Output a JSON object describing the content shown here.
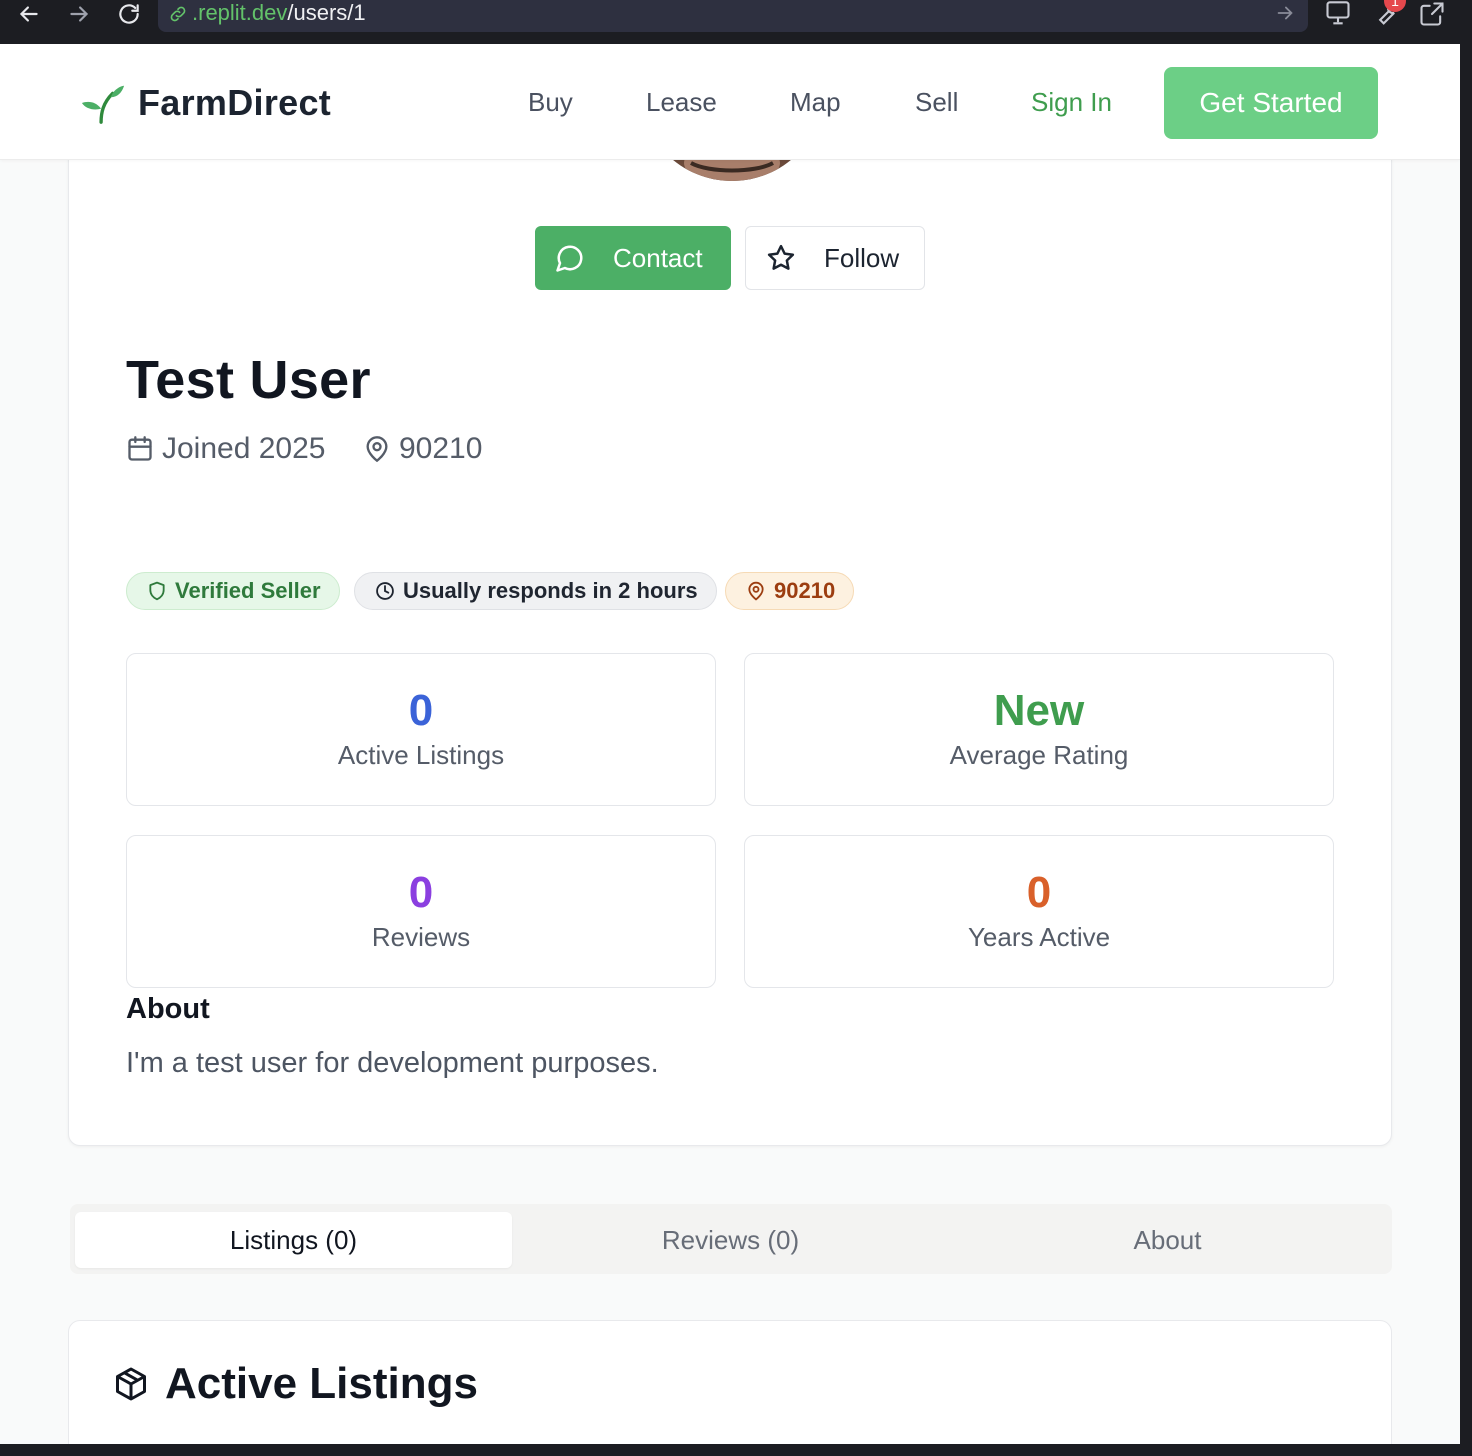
{
  "browser": {
    "url_host": ".replit.dev",
    "url_path": "/users/1",
    "notification_count": "1"
  },
  "header": {
    "brand": "FarmDirect",
    "nav": [
      "Buy",
      "Lease",
      "Map",
      "Sell"
    ],
    "sign_in": "Sign In",
    "get_started": "Get Started"
  },
  "profile": {
    "contact_label": "Contact",
    "follow_label": "Follow",
    "name": "Test User",
    "joined": "Joined 2025",
    "location": "90210",
    "badges": {
      "verified": "Verified Seller",
      "response": "Usually responds in 2 hours",
      "zip": "90210"
    },
    "stats": [
      {
        "value": "0",
        "label": "Active Listings",
        "color": "#3b63d8"
      },
      {
        "value": "New",
        "label": "Average Rating",
        "color": "#3f9d4e"
      },
      {
        "value": "0",
        "label": "Reviews",
        "color": "#8b3fe0"
      },
      {
        "value": "0",
        "label": "Years Active",
        "color": "#d9602a"
      }
    ],
    "about_title": "About",
    "about_text": "I'm a test user for development purposes."
  },
  "tabs": [
    "Listings (0)",
    "Reviews (0)",
    "About"
  ],
  "listings": {
    "title": "Active Listings"
  },
  "colors": {
    "brand_green": "#4caf66",
    "get_started_bg": "#6ccf86"
  }
}
